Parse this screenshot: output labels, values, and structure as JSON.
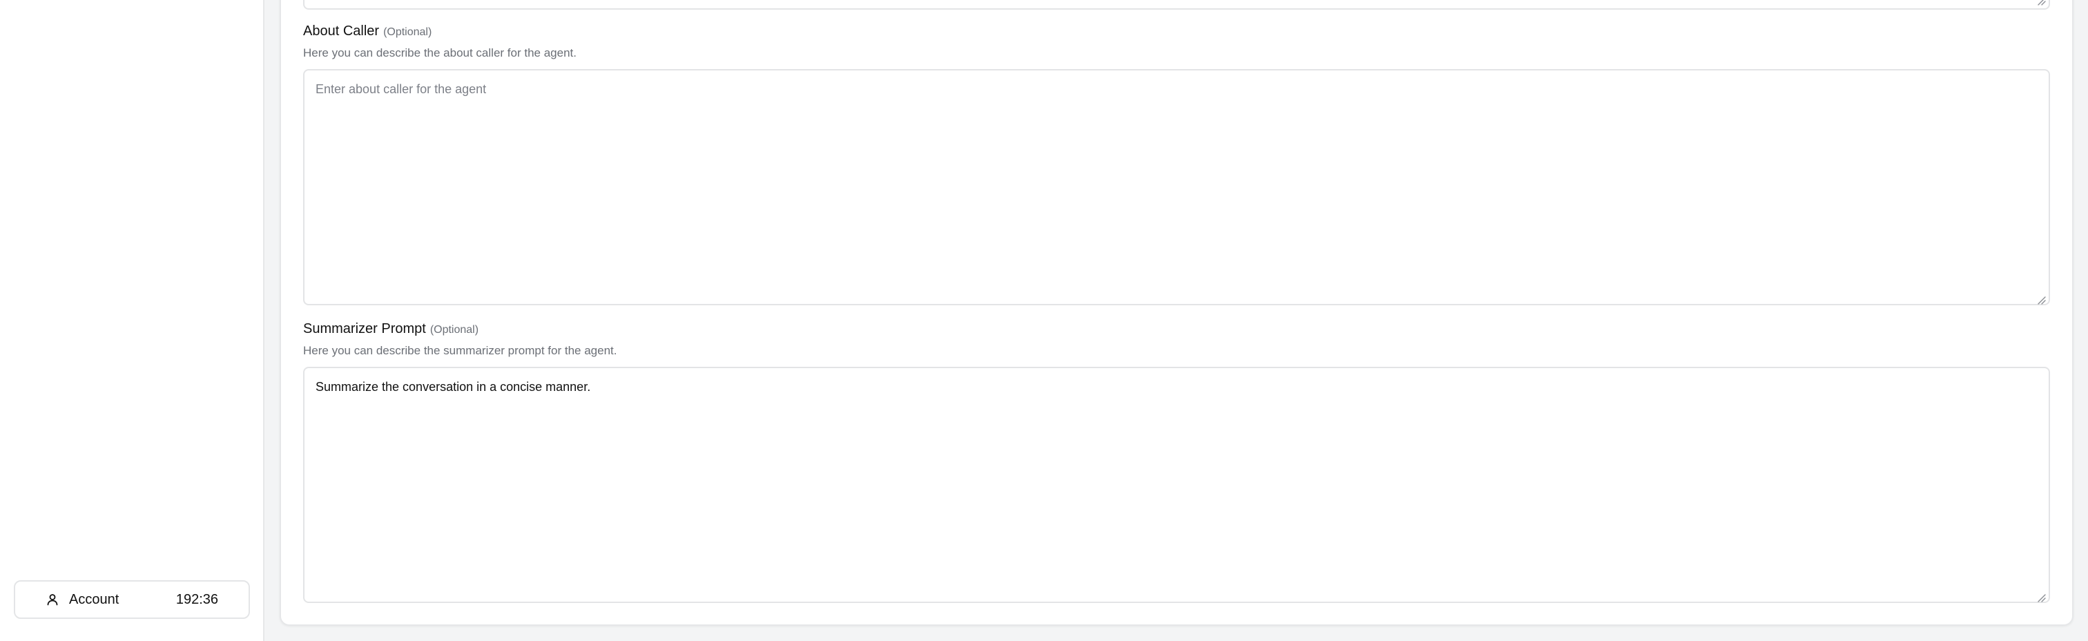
{
  "sidebar": {
    "account": {
      "label": "Account",
      "time": "192:36"
    }
  },
  "fields": {
    "about_caller": {
      "title": "About Caller",
      "optional": "(Optional)",
      "description": "Here you can describe the about caller for the agent.",
      "placeholder": "Enter about caller for the agent",
      "value": ""
    },
    "summarizer_prompt": {
      "title": "Summarizer Prompt",
      "optional": "(Optional)",
      "description": "Here you can describe the summarizer prompt for the agent.",
      "placeholder": "",
      "value": "Summarize the conversation in a concise manner."
    }
  },
  "colors": {
    "page_bg": "#f3f4f5",
    "card_bg": "#ffffff",
    "border": "#e3e4e6",
    "muted_text": "#6b6f76"
  },
  "icons": {
    "account": "user-icon",
    "resize": "resize-grip-icon"
  }
}
